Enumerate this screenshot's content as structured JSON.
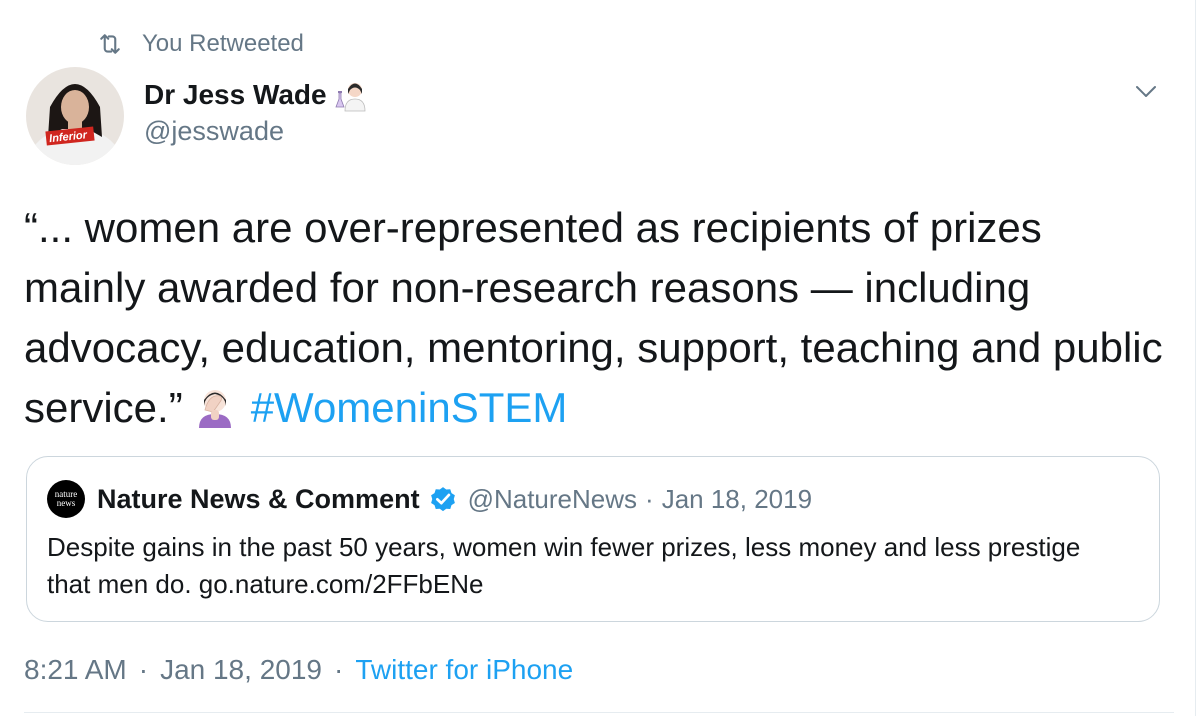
{
  "retweet_context": {
    "label": "You Retweeted",
    "icon": "retweet-icon"
  },
  "author": {
    "name": "Dr Jess Wade",
    "name_emoji": "woman-scientist-emoji",
    "handle": "@jesswade",
    "avatar_shirt_text": "Inferior"
  },
  "tweet": {
    "text_before_emoji": "“... women are over-represented as recipients of prizes mainly awarded for non-research reasons — including advocacy, education, mentoring, support, teaching and public service.”",
    "inline_emoji": "facepalm-emoji",
    "hashtag": "#WomeninSTEM"
  },
  "quoted_tweet": {
    "logo_line1": "nature",
    "logo_line2": "news",
    "name": "Nature News & Comment",
    "verified": true,
    "handle": "@NatureNews",
    "separator": "·",
    "date": "Jan 18, 2019",
    "text": "Despite gains in the past 50 years, women win fewer prizes, less money and less prestige that men do. go.nature.com/2FFbENe"
  },
  "meta": {
    "time": "8:21 AM",
    "separator": "·",
    "date": "Jan 18, 2019",
    "source": "Twitter for iPhone"
  },
  "colors": {
    "link": "#1da1f2",
    "secondary_text": "#657786",
    "primary_text": "#14171a",
    "border": "#ccd6dd"
  }
}
